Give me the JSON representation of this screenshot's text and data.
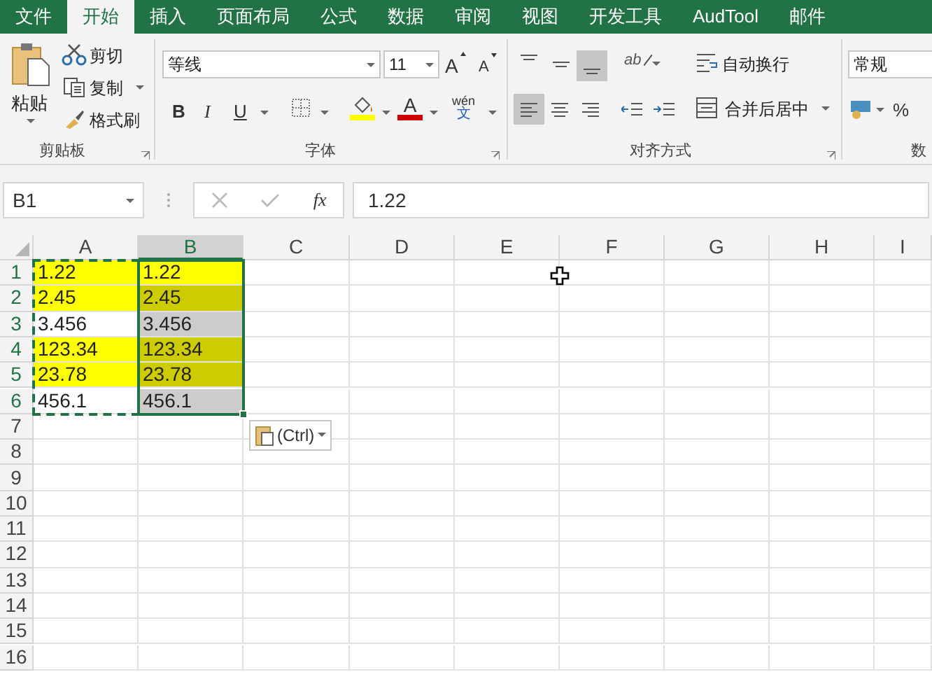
{
  "tabs": [
    {
      "label": "文件",
      "selected": false
    },
    {
      "label": "开始",
      "selected": true
    },
    {
      "label": "插入",
      "selected": false
    },
    {
      "label": "页面布局",
      "selected": false
    },
    {
      "label": "公式",
      "selected": false
    },
    {
      "label": "数据",
      "selected": false
    },
    {
      "label": "审阅",
      "selected": false
    },
    {
      "label": "视图",
      "selected": false
    },
    {
      "label": "开发工具",
      "selected": false
    },
    {
      "label": "AudTool",
      "selected": false
    },
    {
      "label": "邮件",
      "selected": false
    }
  ],
  "ribbon": {
    "clipboard": {
      "paste": "粘贴",
      "cut": "剪切",
      "copy": "复制",
      "format_painter": "格式刷",
      "label": "剪贴板"
    },
    "font": {
      "font_name": "等线",
      "font_size": "11",
      "grow_font": "A",
      "shrink_font": "A",
      "font_color": "A",
      "bold": "B",
      "italic": "I",
      "underline": "U",
      "phonetic_top": "wén",
      "phonetic_bottom": "文",
      "label": "字体"
    },
    "alignment": {
      "orientation": "ab",
      "wrap_text": "自动换行",
      "merge_center": "合并后居中",
      "left_aligned": true,
      "label": "对齐方式"
    },
    "number": {
      "format": "常规",
      "percent": "%",
      "label": "数"
    }
  },
  "formula_bar": {
    "name_box": "B1",
    "fx": "fx",
    "formula": "1.22"
  },
  "sheet": {
    "columns": [
      {
        "label": "A",
        "selected": false
      },
      {
        "label": "B",
        "selected": true
      },
      {
        "label": "C",
        "selected": false
      },
      {
        "label": "D",
        "selected": false
      },
      {
        "label": "E",
        "selected": false
      },
      {
        "label": "F",
        "selected": false
      },
      {
        "label": "G",
        "selected": false
      },
      {
        "label": "H",
        "selected": false
      },
      {
        "label": "I",
        "selected": false
      }
    ],
    "rows": [
      "1",
      "2",
      "3",
      "4",
      "5",
      "6",
      "7",
      "8",
      "9",
      "10",
      "11",
      "12",
      "13",
      "14",
      "15",
      "16"
    ],
    "cells": [
      {
        "a": {
          "value": "1.22",
          "color": "#ffff00"
        },
        "b": {
          "value": "1.22",
          "color": "#ffff00"
        }
      },
      {
        "a": {
          "value": "2.45",
          "color": "#ffff00"
        },
        "b": {
          "value": "2.45",
          "color": "#cccc00"
        }
      },
      {
        "a": {
          "value": "3.456",
          "color": "#ffffff"
        },
        "b": {
          "value": "3.456",
          "color": "#cccccc"
        }
      },
      {
        "a": {
          "value": "123.34",
          "color": "#ffff00"
        },
        "b": {
          "value": "123.34",
          "color": "#cccc00"
        }
      },
      {
        "a": {
          "value": "23.78",
          "color": "#ffff00"
        },
        "b": {
          "value": "23.78",
          "color": "#cccc00"
        }
      },
      {
        "a": {
          "value": "456.1",
          "color": "#ffffff"
        },
        "b": {
          "value": "456.1",
          "color": "#cccccc"
        }
      }
    ],
    "paste_options": "(Ctrl)"
  }
}
